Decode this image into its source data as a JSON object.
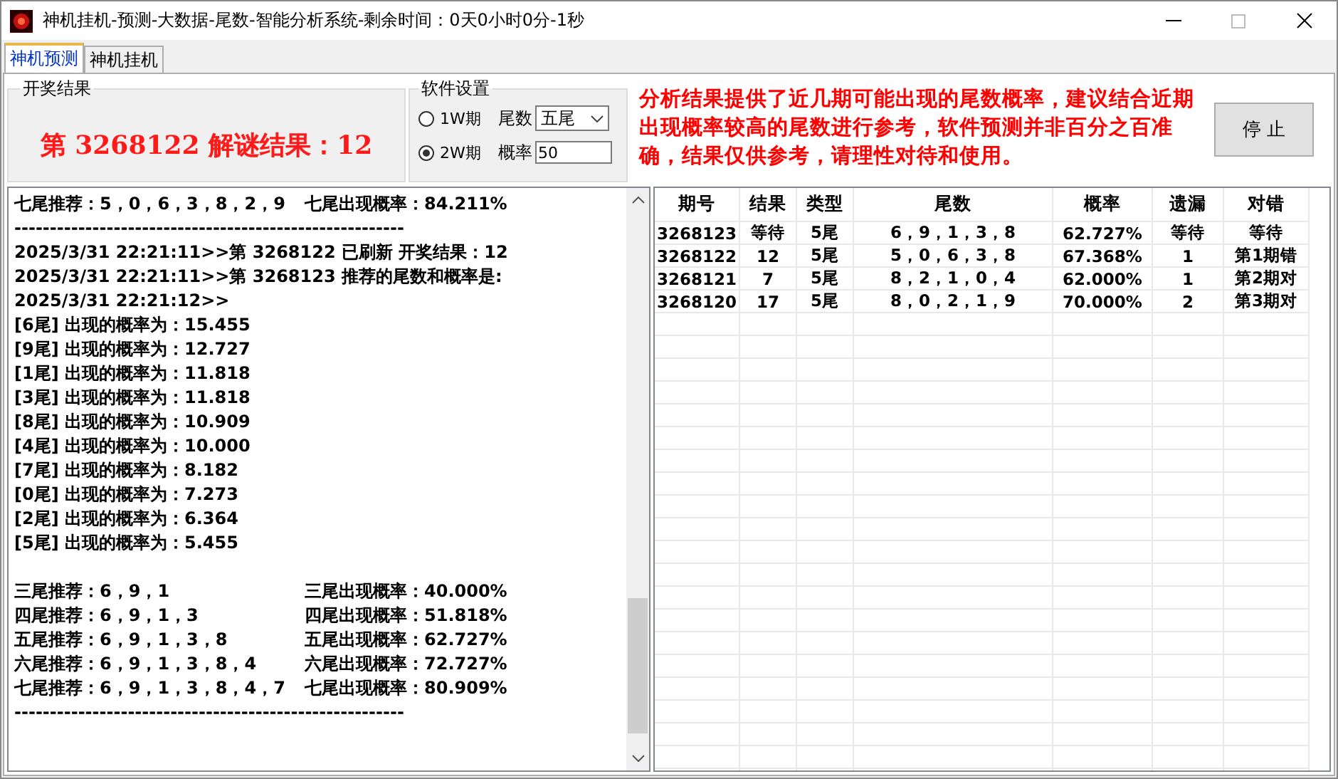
{
  "window": {
    "title": "神机挂机-预测-大数据-尾数-智能分析系统-剩余时间：0天0小时0分-1秒"
  },
  "tabs": [
    {
      "label": "神机预测",
      "selected": true
    },
    {
      "label": "神机挂机",
      "selected": false
    }
  ],
  "result_group": {
    "title": "开奖结果",
    "text": "第 3268122 解谜结果：12"
  },
  "settings_group": {
    "title": "软件设置",
    "radios": [
      {
        "label": "1W期",
        "selected": false
      },
      {
        "label": "2W期",
        "selected": true
      }
    ],
    "tail_label": "尾数",
    "tail_value": "五尾",
    "prob_label": "概率",
    "prob_value": "50"
  },
  "notice": "分析结果提供了近几期可能出现的尾数概率，建议结合近期出现概率较高的尾数进行参考，软件预测并非百分之百准确，结果仅供参考，请理性对待和使用。",
  "stop_button": "停 止",
  "log": [
    {
      "kind": "pair",
      "left": "七尾推荐：5，0，6，3，8，2，9",
      "right": "七尾出现概率：84.211%"
    },
    {
      "kind": "text",
      "text": "-------------------------------------------------------"
    },
    {
      "kind": "text",
      "text": "2025/3/31  22:21:11>>第 3268122 已刷新 开奖结果：12"
    },
    {
      "kind": "text",
      "text": "2025/3/31  22:21:11>>第 3268123 推荐的尾数和概率是:"
    },
    {
      "kind": "text",
      "text": "2025/3/31  22:21:12>>"
    },
    {
      "kind": "text",
      "text": "[6尾]  出现的概率为：15.455"
    },
    {
      "kind": "text",
      "text": "[9尾]  出现的概率为：12.727"
    },
    {
      "kind": "text",
      "text": "[1尾]  出现的概率为：11.818"
    },
    {
      "kind": "text",
      "text": "[3尾]  出现的概率为：11.818"
    },
    {
      "kind": "text",
      "text": "[8尾]  出现的概率为：10.909"
    },
    {
      "kind": "text",
      "text": "[4尾]  出现的概率为：10.000"
    },
    {
      "kind": "text",
      "text": "[7尾]  出现的概率为：8.182"
    },
    {
      "kind": "text",
      "text": "[0尾]  出现的概率为：7.273"
    },
    {
      "kind": "text",
      "text": "[2尾]  出现的概率为：6.364"
    },
    {
      "kind": "text",
      "text": "[5尾]  出现的概率为：5.455"
    },
    {
      "kind": "blank"
    },
    {
      "kind": "pair",
      "left": "三尾推荐：6，9，1",
      "right": "三尾出现概率：40.000%"
    },
    {
      "kind": "pair",
      "left": "四尾推荐：6，9，1，3",
      "right": "四尾出现概率：51.818%"
    },
    {
      "kind": "pair",
      "left": "五尾推荐：6，9，1，3，8",
      "right": "五尾出现概率：62.727%"
    },
    {
      "kind": "pair",
      "left": "六尾推荐：6，9，1，3，8，4",
      "right": "六尾出现概率：72.727%"
    },
    {
      "kind": "pair",
      "left": "七尾推荐：6，9，1，3，8，4，7",
      "right": "七尾出现概率：80.909%"
    },
    {
      "kind": "text",
      "text": "-------------------------------------------------------"
    }
  ],
  "table": {
    "columns": [
      "期号",
      "结果",
      "类型",
      "尾数",
      "概率",
      "遗漏",
      "对错"
    ],
    "rows": [
      [
        "3268123",
        "等待",
        "5尾",
        "6，9，1，3，8",
        "62.727%",
        "等待",
        "等待"
      ],
      [
        "3268122",
        "12",
        "5尾",
        "5，0，6，3，8",
        "67.368%",
        "1",
        "第1期错"
      ],
      [
        "3268121",
        "7",
        "5尾",
        "8，2，1，0，4",
        "62.000%",
        "1",
        "第2期对"
      ],
      [
        "3268120",
        "17",
        "5尾",
        "8，0，2，1，9",
        "70.000%",
        "2",
        "第3期对"
      ]
    ]
  }
}
